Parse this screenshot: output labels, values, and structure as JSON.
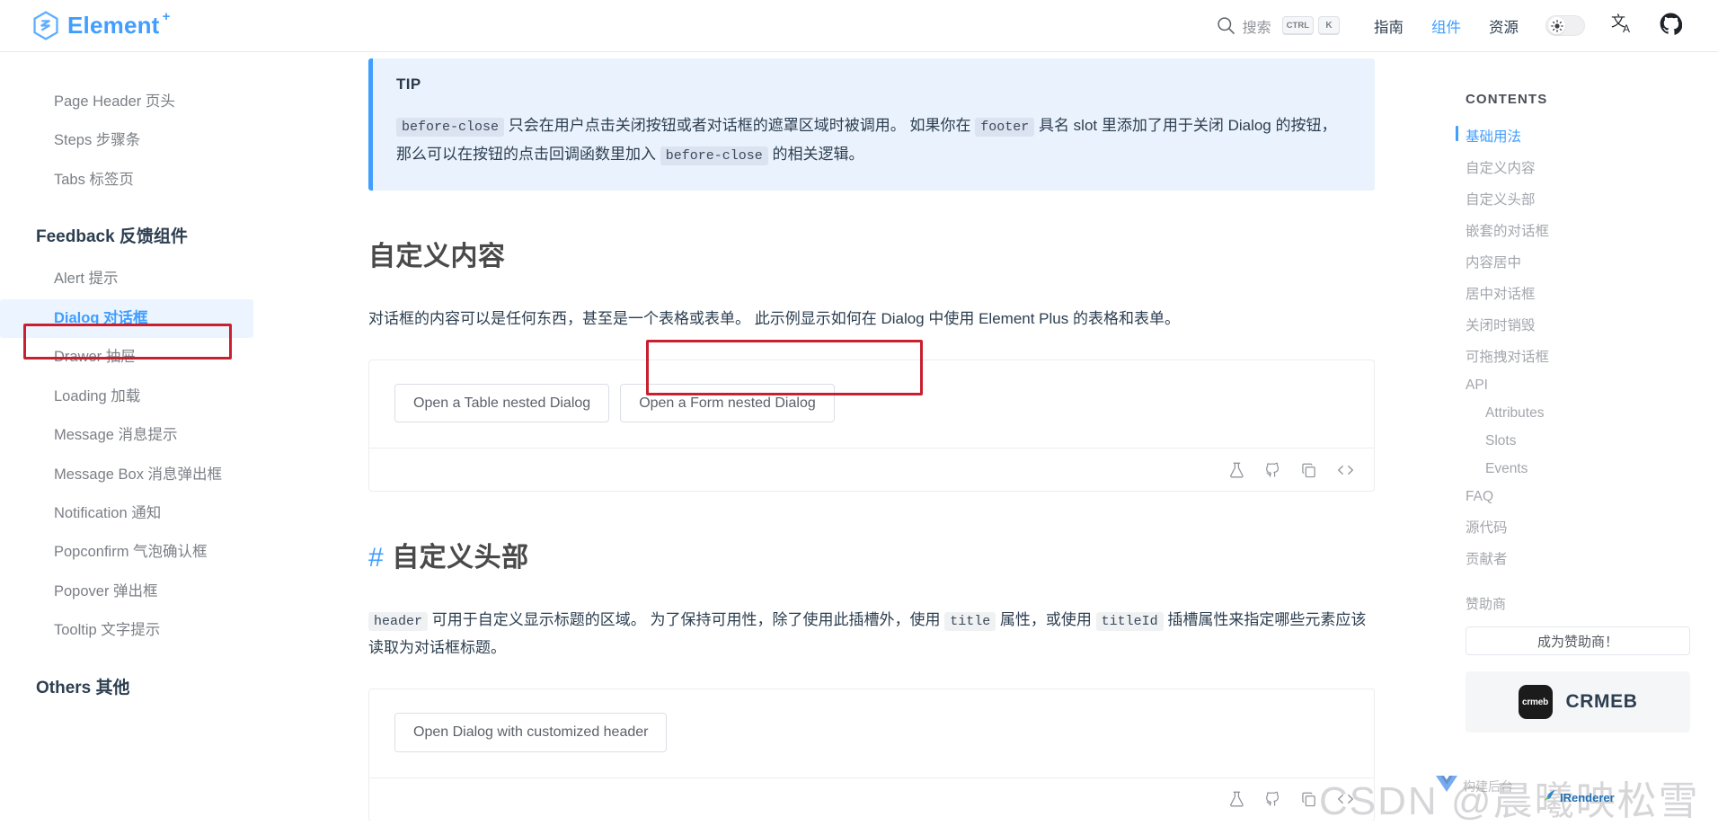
{
  "header": {
    "brand": "Element",
    "brand_suffix": "+",
    "search_placeholder": "搜索",
    "kbd": [
      "CTRL",
      "K"
    ],
    "nav": [
      {
        "label": "指南",
        "active": false
      },
      {
        "label": "组件",
        "active": true
      },
      {
        "label": "资源",
        "active": false
      }
    ],
    "theme_icon": "sun-icon",
    "lang_icon": "translate-icon",
    "github_icon": "github-icon",
    "accent_color": "#409eff"
  },
  "sidebar": {
    "items": [
      {
        "label": "Page Header 页头",
        "type": "item",
        "active": false
      },
      {
        "label": "Steps 步骤条",
        "type": "item",
        "active": false
      },
      {
        "label": "Tabs 标签页",
        "type": "item",
        "active": false
      },
      {
        "label": "Feedback 反馈组件",
        "type": "group"
      },
      {
        "label": "Alert 提示",
        "type": "item",
        "active": false
      },
      {
        "label": "Dialog 对话框",
        "type": "item",
        "active": true
      },
      {
        "label": "Drawer 抽屉",
        "type": "item",
        "active": false
      },
      {
        "label": "Loading 加载",
        "type": "item",
        "active": false
      },
      {
        "label": "Message 消息提示",
        "type": "item",
        "active": false
      },
      {
        "label": "Message Box 消息弹出框",
        "type": "item",
        "active": false
      },
      {
        "label": "Notification 通知",
        "type": "item",
        "active": false
      },
      {
        "label": "Popconfirm 气泡确认框",
        "type": "item",
        "active": false
      },
      {
        "label": "Popover 弹出框",
        "type": "item",
        "active": false
      },
      {
        "label": "Tooltip 文字提示",
        "type": "item",
        "active": false
      },
      {
        "label": "Others 其他",
        "type": "group"
      }
    ],
    "highlight_color": "#c9202f"
  },
  "main": {
    "tip": {
      "title": "TIP",
      "code1": "before-close",
      "text1": " 只会在用户点击关闭按钮或者对话框的遮罩区域时被调用。 如果你在 ",
      "code2": "footer",
      "text2": " 具名 slot 里添加了用于关闭 Dialog 的按钮，那么可以在按钮的点击回调函数里加入 ",
      "code3": "before-close",
      "text3": " 的相关逻辑。"
    },
    "section1": {
      "title": "自定义内容",
      "desc": "对话框的内容可以是任何东西，甚至是一个表格或表单。 此示例显示如何在 Dialog 中使用 Element Plus 的表格和表单。",
      "buttons": [
        {
          "label": "Open a Table nested Dialog",
          "highlighted": false
        },
        {
          "label": "Open a Form nested Dialog",
          "highlighted": true
        }
      ],
      "tools": [
        "flask-icon",
        "github-icon",
        "copy-icon",
        "code-icon"
      ]
    },
    "section2": {
      "anchor": "#",
      "title": "自定义头部",
      "desc_code1": "header",
      "desc_text1": " 可用于自定义显示标题的区域。 为了保持可用性，除了使用此插槽外，使用 ",
      "desc_code2": "title",
      "desc_text2": " 属性，或使用 ",
      "desc_code3": "titleId",
      "desc_text3": " 插槽属性来指定哪些元素应该读取为对话框标题。",
      "buttons": [
        {
          "label": "Open Dialog with customized header",
          "highlighted": false
        }
      ],
      "tools": [
        "flask-icon",
        "github-icon",
        "copy-icon",
        "code-icon"
      ]
    }
  },
  "aside": {
    "title": "CONTENTS",
    "toc": [
      {
        "label": "基础用法",
        "active": true,
        "sub": false
      },
      {
        "label": "自定义内容",
        "active": false,
        "sub": false
      },
      {
        "label": "自定义头部",
        "active": false,
        "sub": false
      },
      {
        "label": "嵌套的对话框",
        "active": false,
        "sub": false
      },
      {
        "label": "内容居中",
        "active": false,
        "sub": false
      },
      {
        "label": "居中对话框",
        "active": false,
        "sub": false
      },
      {
        "label": "关闭时销毁",
        "active": false,
        "sub": false
      },
      {
        "label": "可拖拽对话框",
        "active": false,
        "sub": false
      },
      {
        "label": "API",
        "active": false,
        "sub": false
      },
      {
        "label": "Attributes",
        "active": false,
        "sub": true
      },
      {
        "label": "Slots",
        "active": false,
        "sub": true
      },
      {
        "label": "Events",
        "active": false,
        "sub": true
      },
      {
        "label": "FAQ",
        "active": false,
        "sub": false
      },
      {
        "label": "源代码",
        "active": false,
        "sub": false
      },
      {
        "label": "贡献者",
        "active": false,
        "sub": false
      }
    ],
    "sponsor_label": "赞助商",
    "sponsor_button": "成为赞助商！",
    "sponsor_logo_text": "crmeb",
    "sponsor_name": "CRMEB"
  },
  "watermarks": {
    "csdn": "CSDN @晨曦映松雪",
    "vue_text": "构建后台",
    "irenderer": "IRenderer"
  }
}
